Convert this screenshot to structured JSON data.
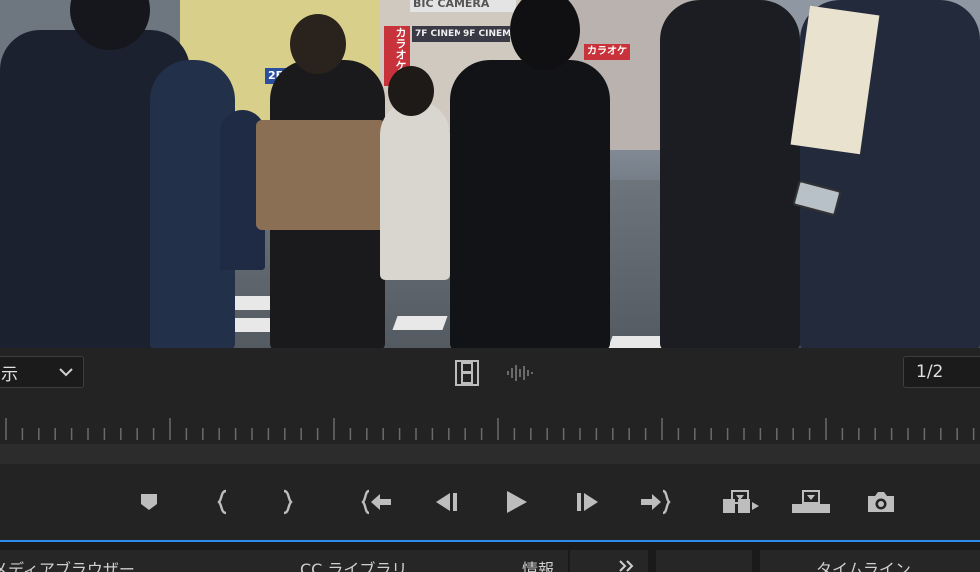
{
  "viewer": {
    "scale_select_value": "示",
    "resolution_select_value": "1/2"
  },
  "icons": {
    "dropdown": "chevron-down-icon",
    "video": "film-strip-icon",
    "audio": "audio-waveform-icon",
    "marker": "marker-icon",
    "mark_in": "mark-in-icon",
    "mark_out": "mark-out-icon",
    "go_to_in": "go-to-in-icon",
    "step_back": "step-back-icon",
    "play": "play-icon",
    "step_forward": "step-forward-icon",
    "go_to_out": "go-to-out-icon",
    "insert": "insert-icon",
    "overwrite": "overwrite-icon",
    "export_frame": "camera-icon",
    "panel_overflow": "double-chevron-icon"
  },
  "scene": {
    "signs": [
      "BIC CAMERA",
      "カラオケ",
      "7F CINEMA",
      "9F CINEMA",
      "2F",
      "カラオケ"
    ]
  },
  "bottom_tabs": {
    "media_browser": "メディアブラウザー",
    "libraries": "CC ライブラリ",
    "info": "情報",
    "timeline": "タイムライン"
  },
  "colors": {
    "accent_blue": "#2d8ceb",
    "panel_bg": "#232323",
    "icon_gray": "#bdbdbd"
  }
}
